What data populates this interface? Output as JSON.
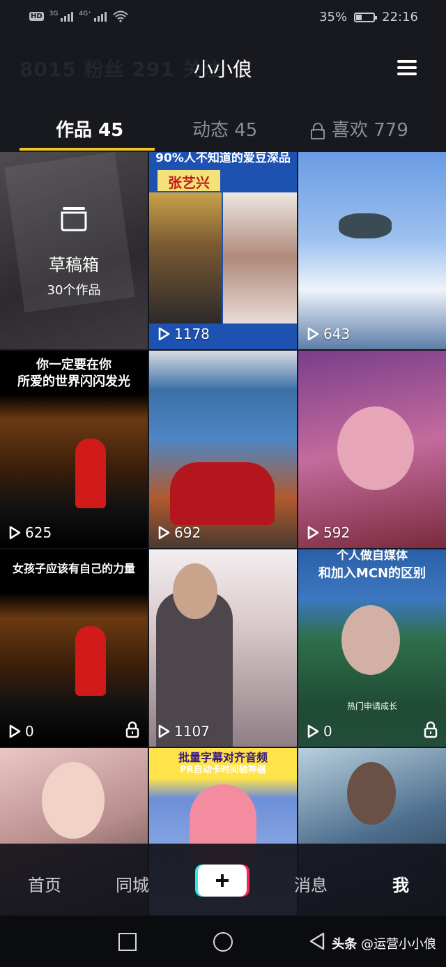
{
  "status_bar": {
    "hd_label": "HD",
    "net_label_1": "3G",
    "net_label_2": "4G⁺",
    "battery_percent": "35%",
    "battery_level": 0.35,
    "time": "22:16"
  },
  "header": {
    "ghost_text": "8015 粉丝 291 关注",
    "title": "小小俍"
  },
  "tabs": [
    {
      "label": "作品 45",
      "active": true
    },
    {
      "label": "动态 45",
      "active": false
    },
    {
      "label": "喜欢 779",
      "active": false,
      "icon": "lock-icon"
    }
  ],
  "drafts": {
    "title": "草稿箱",
    "count": "30个作品"
  },
  "videos": [
    {
      "caption": "90%人不知道的爱豆深品",
      "subcaption": "张艺兴",
      "views": "1178",
      "locked": false
    },
    {
      "caption": "",
      "views": "643",
      "locked": false
    },
    {
      "caption": "你一定要在你",
      "subcaption": "所爱的世界闪闪发光",
      "views": "625",
      "locked": false
    },
    {
      "caption": "",
      "views": "692",
      "locked": false
    },
    {
      "caption": "",
      "views": "592",
      "locked": false
    },
    {
      "caption": "女孩子应该有自己的力量",
      "views": "0",
      "locked": true
    },
    {
      "caption": "",
      "views": "1107",
      "locked": false
    },
    {
      "caption": "个人做自媒体",
      "subcaption": "和加入MCN的区别",
      "footnote": "热门申请成长",
      "views": "0",
      "locked": true
    },
    {
      "caption": "",
      "views": "",
      "locked": false
    },
    {
      "caption": "批量字幕对齐音频",
      "subcaption": "PR自动卡时间轴神器",
      "views": "",
      "locked": false
    },
    {
      "caption": "",
      "views": "",
      "locked": false
    }
  ],
  "bottom_nav": {
    "home": "首页",
    "city": "同城",
    "messages": "消息",
    "me": "我"
  },
  "watermark": {
    "brand": "头条",
    "handle": "@运营小小俍"
  },
  "colors": {
    "background": "#14161d",
    "tab_indicator": "#f3c321",
    "plus_left": "#35e6ef",
    "plus_right": "#ee2b58"
  }
}
